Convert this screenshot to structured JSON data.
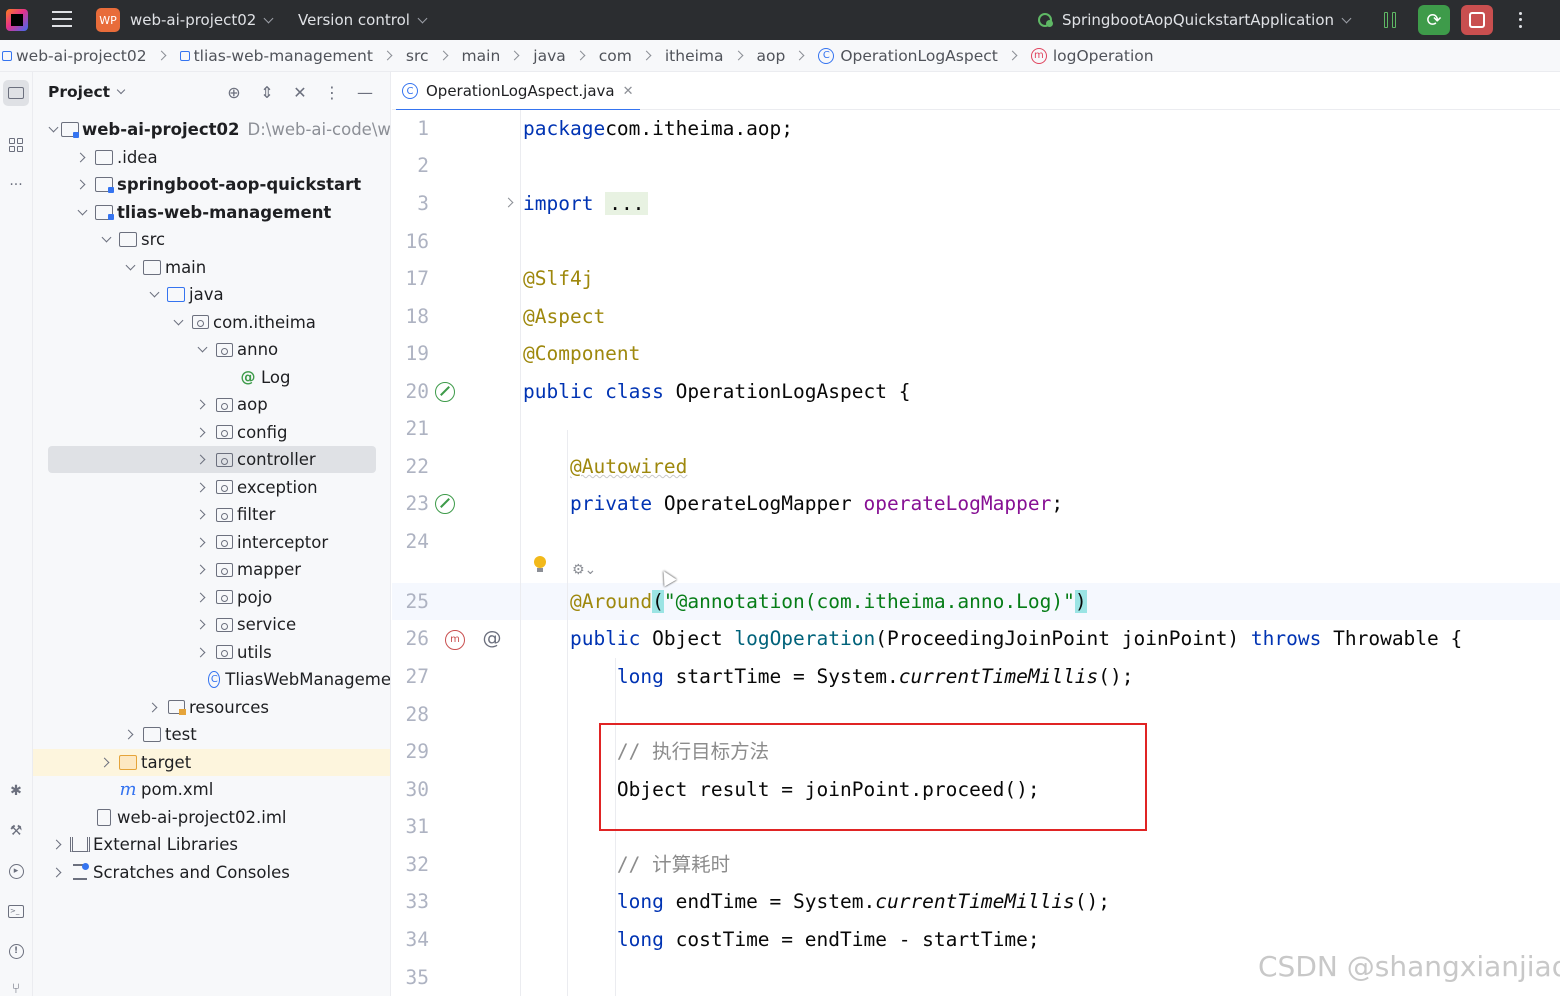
{
  "titlebar": {
    "project_badge": "WP",
    "project_name": "web-ai-project02",
    "vcs_label": "Version control",
    "run_config": "SpringbootAopQuickstartApplication"
  },
  "breadcrumb": [
    "web-ai-project02",
    "tlias-web-management",
    "src",
    "main",
    "java",
    "com",
    "itheima",
    "aop",
    "OperationLogAspect",
    "logOperation"
  ],
  "project_panel": {
    "title": "Project",
    "tree": [
      {
        "label": "web-ai-project02",
        "path": "D:\\web-ai-code\\we",
        "bold": true,
        "icon": "module",
        "arrow": "d",
        "depth": 0
      },
      {
        "label": ".idea",
        "icon": "folder",
        "arrow": "r",
        "depth": 1
      },
      {
        "label": "springboot-aop-quickstart",
        "bold": true,
        "icon": "module",
        "arrow": "r",
        "depth": 1
      },
      {
        "label": "tlias-web-management",
        "bold": true,
        "icon": "module",
        "arrow": "d",
        "depth": 1
      },
      {
        "label": "src",
        "icon": "folder",
        "arrow": "d",
        "depth": 2
      },
      {
        "label": "main",
        "icon": "folder",
        "arrow": "d",
        "depth": 3
      },
      {
        "label": "java",
        "icon": "folder-blue",
        "arrow": "d",
        "depth": 4
      },
      {
        "label": "com.itheima",
        "icon": "package",
        "arrow": "d",
        "depth": 5
      },
      {
        "label": "anno",
        "icon": "package",
        "arrow": "d",
        "depth": 6
      },
      {
        "label": "Log",
        "icon": "annotation",
        "arrow": "none",
        "depth": 7
      },
      {
        "label": "aop",
        "icon": "package",
        "arrow": "r",
        "depth": 6
      },
      {
        "label": "config",
        "icon": "package",
        "arrow": "r",
        "depth": 6
      },
      {
        "label": "controller",
        "icon": "package",
        "arrow": "r",
        "depth": 6,
        "selected": true
      },
      {
        "label": "exception",
        "icon": "package",
        "arrow": "r",
        "depth": 6
      },
      {
        "label": "filter",
        "icon": "package",
        "arrow": "r",
        "depth": 6
      },
      {
        "label": "interceptor",
        "icon": "package",
        "arrow": "r",
        "depth": 6
      },
      {
        "label": "mapper",
        "icon": "package",
        "arrow": "r",
        "depth": 6
      },
      {
        "label": "pojo",
        "icon": "package",
        "arrow": "r",
        "depth": 6
      },
      {
        "label": "service",
        "icon": "package",
        "arrow": "r",
        "depth": 6
      },
      {
        "label": "utils",
        "icon": "package",
        "arrow": "r",
        "depth": 6
      },
      {
        "label": "TliasWebManageme",
        "icon": "class",
        "arrow": "none",
        "depth": 6
      },
      {
        "label": "resources",
        "icon": "resources",
        "arrow": "r",
        "depth": 4
      },
      {
        "label": "test",
        "icon": "folder",
        "arrow": "r",
        "depth": 3
      },
      {
        "label": "target",
        "icon": "folder-orange",
        "arrow": "r",
        "depth": 2,
        "excluded": true
      },
      {
        "label": "pom.xml",
        "icon": "maven",
        "arrow": "none",
        "depth": 2
      },
      {
        "label": "web-ai-project02.iml",
        "icon": "file",
        "arrow": "none",
        "depth": 1
      },
      {
        "label": "External Libraries",
        "icon": "library",
        "arrow": "r",
        "depth": 0
      },
      {
        "label": "Scratches and Consoles",
        "icon": "scratch",
        "arrow": "r",
        "depth": 0
      }
    ]
  },
  "editor": {
    "tab_label": "OperationLogAspect.java",
    "lines": [
      {
        "n": "1",
        "segs": [
          [
            "kw",
            "package"
          ],
          [
            "",
            "com.itheima.aop;"
          ]
        ]
      },
      {
        "n": "2",
        "segs": []
      },
      {
        "n": "3",
        "segs": [
          [
            "kw",
            "import"
          ],
          [
            "",
            " "
          ],
          [
            "chip",
            "..."
          ]
        ]
      },
      {
        "n": "16",
        "segs": []
      },
      {
        "n": "17",
        "segs": [
          [
            "an",
            "@Slf4j"
          ]
        ]
      },
      {
        "n": "18",
        "segs": [
          [
            "an",
            "@Aspect"
          ]
        ]
      },
      {
        "n": "19",
        "segs": [
          [
            "an",
            "@Component"
          ]
        ]
      },
      {
        "n": "20",
        "segs": [
          [
            "kw",
            "public class"
          ],
          [
            "",
            " OperationLogAspect {"
          ]
        ]
      },
      {
        "n": "21",
        "segs": []
      },
      {
        "n": "22",
        "segs": [
          [
            "",
            "    "
          ],
          [
            "an undl",
            "@Autowired"
          ]
        ]
      },
      {
        "n": "23",
        "segs": [
          [
            "",
            "    "
          ],
          [
            "kw",
            "private"
          ],
          [
            "",
            " OperateLogMapper "
          ],
          [
            "fld",
            "operateLogMapper"
          ],
          [
            "",
            ";"
          ]
        ]
      },
      {
        "n": "24",
        "segs": []
      },
      {
        "n": "25",
        "segs": [
          [
            "",
            "    "
          ],
          [
            "an",
            "@Around"
          ],
          [
            "brace",
            "("
          ],
          [
            "str",
            "\"@annotation(com.itheima.anno.Log)\""
          ],
          [
            "brace",
            ")"
          ]
        ]
      },
      {
        "n": "26",
        "segs": [
          [
            "",
            "    "
          ],
          [
            "kw",
            "public"
          ],
          [
            "",
            " Object "
          ],
          [
            "mth",
            "logOperation"
          ],
          [
            "",
            "(ProceedingJoinPoint joinPoint) "
          ],
          [
            "kw",
            "throws"
          ],
          [
            "",
            " Throwable {"
          ]
        ]
      },
      {
        "n": "27",
        "segs": [
          [
            "",
            "        "
          ],
          [
            "kw",
            "long"
          ],
          [
            "",
            " startTime = System."
          ],
          [
            "it",
            "currentTimeMillis"
          ],
          [
            "",
            "();"
          ]
        ]
      },
      {
        "n": "28",
        "segs": []
      },
      {
        "n": "29",
        "segs": [
          [
            "",
            "        "
          ],
          [
            "cmt",
            "// 执行目标方法"
          ]
        ]
      },
      {
        "n": "30",
        "segs": [
          [
            "",
            "        Object result = joinPoint.proceed();"
          ]
        ]
      },
      {
        "n": "31",
        "segs": []
      },
      {
        "n": "32",
        "segs": [
          [
            "",
            "        "
          ],
          [
            "cmt",
            "// 计算耗时"
          ]
        ]
      },
      {
        "n": "33",
        "segs": [
          [
            "",
            "        "
          ],
          [
            "kw",
            "long"
          ],
          [
            "",
            " endTime = System."
          ],
          [
            "it",
            "currentTimeMillis"
          ],
          [
            "",
            "();"
          ]
        ]
      },
      {
        "n": "34",
        "segs": [
          [
            "",
            "        "
          ],
          [
            "kw",
            "long"
          ],
          [
            "",
            " costTime = endTime - startTime;"
          ]
        ]
      },
      {
        "n": "35",
        "segs": []
      }
    ]
  },
  "watermark": "CSDN @shangxianjiao",
  "colors": {
    "titlebar": "#2b2d30",
    "accent": "#3574f0",
    "keyword": "#0033b3",
    "annotation": "#9e880d",
    "string": "#067d17",
    "highlight_box": "#e02424"
  }
}
